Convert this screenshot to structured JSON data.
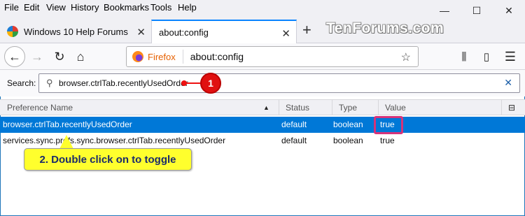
{
  "menu": {
    "file": "File",
    "edit": "Edit",
    "view": "View",
    "history": "History",
    "bookmarks": "Bookmarks",
    "tools": "Tools",
    "help": "Help"
  },
  "window_controls": {
    "minimize": "—",
    "maximize": "☐",
    "close": "✕"
  },
  "tabs": [
    {
      "title": "Windows 10 Help Forums"
    },
    {
      "title": "about:config"
    }
  ],
  "watermark": "TenForums.com",
  "urlbar": {
    "identity": "Firefox",
    "url": "about:config"
  },
  "search": {
    "label": "Search:",
    "value": "browser.ctrlTab.recentlyUsedOrder"
  },
  "table": {
    "columns": [
      "Preference Name",
      "Status",
      "Type",
      "Value"
    ],
    "rows": [
      {
        "name": "browser.ctrlTab.recentlyUsedOrder",
        "status": "default",
        "type": "boolean",
        "value": "true"
      },
      {
        "name": "services.sync.prefs.sync.browser.ctrlTab.recentlyUsedOrder",
        "status": "default",
        "type": "boolean",
        "value": "true"
      }
    ]
  },
  "annotations": {
    "step1": "1",
    "step2": "2. Double click on to toggle"
  },
  "colors": {
    "selection": "#0078d7",
    "callout": "#e01010",
    "highlight_box": "#d6337a",
    "tooltip": "#ffff2d"
  }
}
